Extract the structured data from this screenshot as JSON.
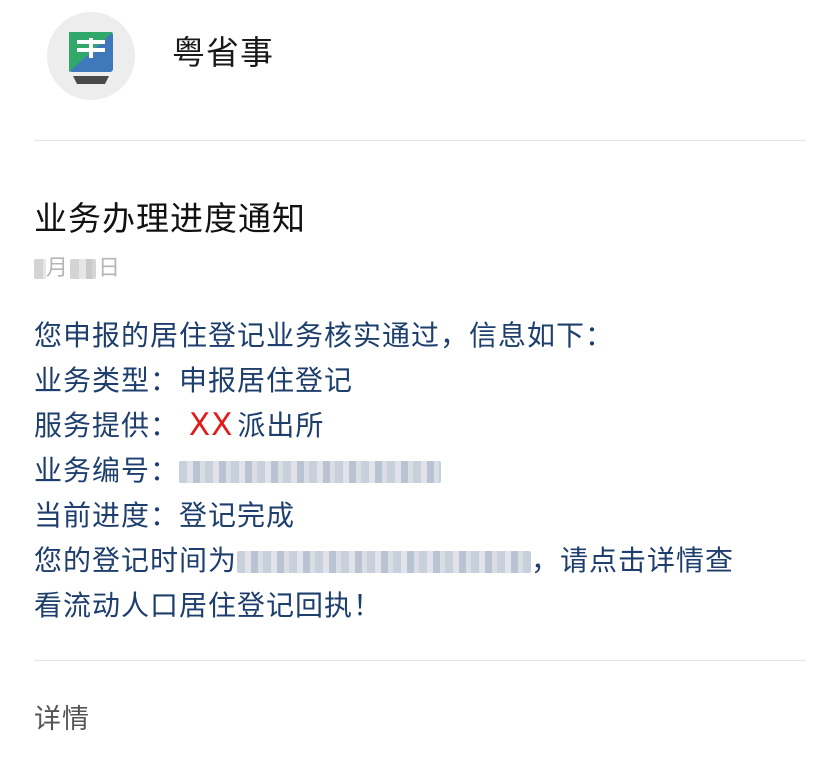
{
  "app": {
    "name": "粤省事",
    "icon": "yue-logo-icon",
    "icon_letter": "粤"
  },
  "message": {
    "title": "业务办理进度通知",
    "date_fragments": [
      "月",
      "日"
    ],
    "intro": "您申报的居住登记业务核实通过，信息如下：",
    "business_type_label": "业务类型：",
    "business_type_value": "申报居住登记",
    "service_label": "服务提供：",
    "service_prefix": "XX",
    "service_value": "派出所",
    "business_no_label": "业务编号：",
    "progress_label": "当前进度：",
    "progress_value": "登记完成",
    "time_prefix": "您的登记时间为",
    "time_suffix": "，请点击详情查",
    "closing": "看流动人口居住登记回执！"
  },
  "footer": {
    "detail_label": "详情"
  },
  "colors": {
    "body_text": "#1e3f6e",
    "highlight": "#e21b1b",
    "logo_green": "#2fa86a",
    "logo_blue": "#2b6bb5"
  }
}
